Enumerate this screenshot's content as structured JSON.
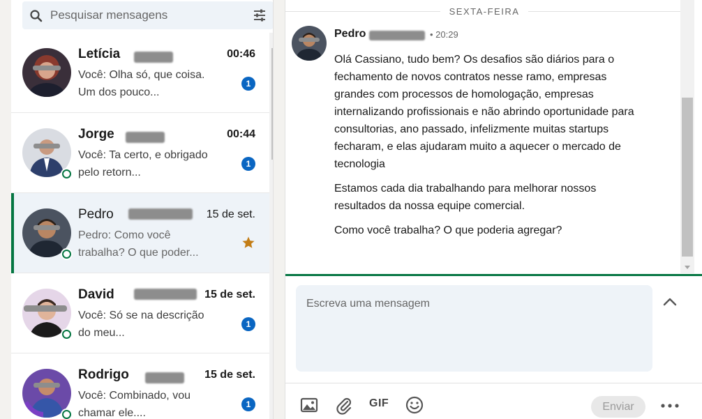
{
  "search": {
    "placeholder": "Pesquisar mensagens"
  },
  "conversations": [
    {
      "name": "Letícia",
      "time": "00:46",
      "preview": "Você: Olha só, que coisa. Um dos pouco...",
      "unread": "1"
    },
    {
      "name": "Jorge",
      "time": "00:44",
      "preview": "Você: Ta certo, e obrigado pelo retorn...",
      "unread": "1"
    },
    {
      "name": "Pedro",
      "time": "15 de set.",
      "preview": "Pedro: Como você trabalha? O que poder..."
    },
    {
      "name": "David",
      "time": "15 de set.",
      "preview": "Você: Só se na descrição do meu...",
      "unread": "1"
    },
    {
      "name": "Rodrigo",
      "time": "15 de set.",
      "preview": "Você: Combinado, vou chamar ele....",
      "unread": "1"
    }
  ],
  "thread": {
    "day_divider": "SEXTA-FEIRA",
    "message": {
      "sender": "Pedro",
      "time": "• 20:29",
      "paragraphs": [
        "Olá Cassiano, tudo bem? Os desafios são diários para o fechamento de novos contratos nesse ramo, empresas grandes com processos de homologação, empresas internalizando profissionais e não abrindo oportunidade para consultorias, ano passado, infelizmente muitas startups fecharam, e elas ajudaram muito a aquecer o mercado de tecnologia",
        "Estamos cada dia trabalhando para melhorar nossos resultados da nossa equipe comercial.",
        "Como você trabalha? O que poderia agregar?"
      ]
    }
  },
  "compose": {
    "placeholder": "Escreva uma mensagem",
    "gif_label": "GIF",
    "send_label": "Enviar"
  },
  "colors": {
    "accent_green": "#057642",
    "badge_blue": "#0a66c2",
    "star_orange": "#c37d16",
    "search_bg": "#eef3f8"
  },
  "icons": [
    "search-icon",
    "filter-icon",
    "star-icon",
    "image-icon",
    "paperclip-icon",
    "emoji-icon",
    "chevron-up-icon",
    "more-icon"
  ]
}
